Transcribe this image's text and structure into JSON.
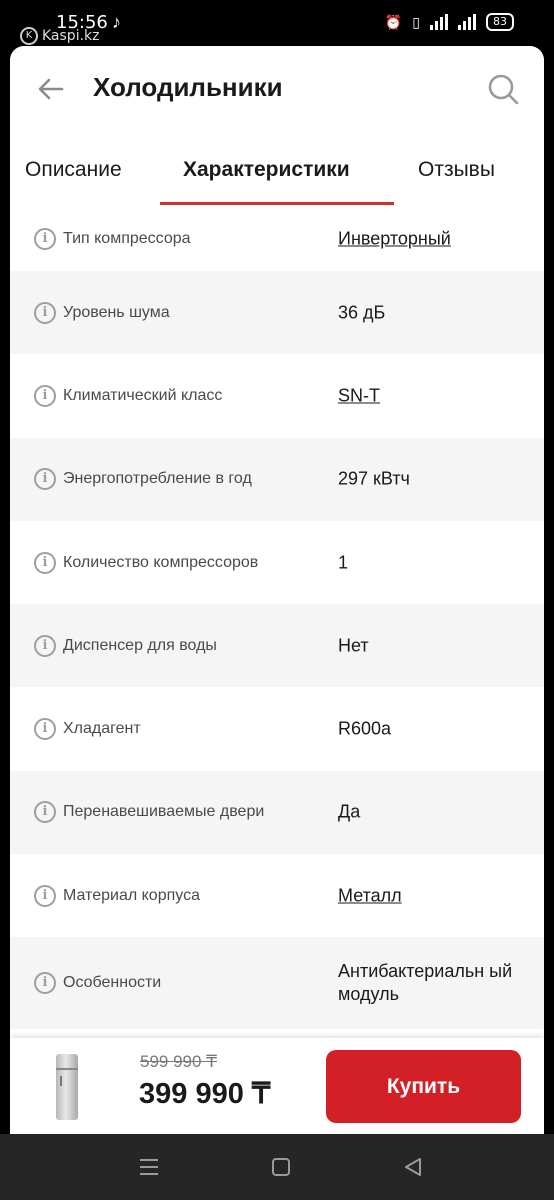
{
  "status_bar": {
    "time": "15:56",
    "watermark": "Kaspi.kz",
    "battery": "83"
  },
  "header": {
    "title": "Холодильники"
  },
  "tabs": [
    {
      "label": "Описание",
      "active": false
    },
    {
      "label": "Характеристики",
      "active": true
    },
    {
      "label": "Отзывы",
      "active": false
    }
  ],
  "specs": [
    {
      "label": "Тип компрессора",
      "value": "Инверторный",
      "link": true
    },
    {
      "label": "Уровень шума",
      "value": "36 дБ",
      "link": false
    },
    {
      "label": "Климатический класс",
      "value": "SN-T",
      "link": true
    },
    {
      "label": "Энергопотребление в год",
      "value": "297 кВтч",
      "link": false
    },
    {
      "label": "Количество компрессоров",
      "value": "1",
      "link": false
    },
    {
      "label": "Диспенсер для воды",
      "value": "Нет",
      "link": false
    },
    {
      "label": "Хладагент",
      "value": "R600a",
      "link": false
    },
    {
      "label": "Перенавешиваемые двери",
      "value": "Да",
      "link": false
    },
    {
      "label": "Материал корпуса",
      "value": "Металл",
      "link": true
    },
    {
      "label": "Особенности",
      "value": "Антибактериальн ый модуль",
      "link": false
    }
  ],
  "bottom": {
    "old_price": "599 990 ₸",
    "price": "399 990 ₸",
    "buy_label": "Купить"
  },
  "colors": {
    "accent": "#d32027",
    "tab_indicator": "#d32f2f"
  }
}
